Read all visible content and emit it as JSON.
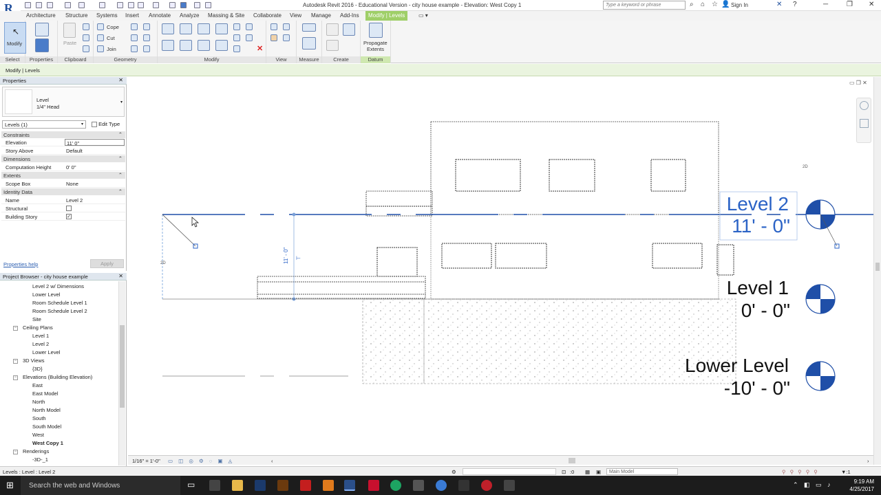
{
  "window": {
    "title": "Autodesk Revit 2016 - Educational Version -   city house example - Elevation: West Copy 1"
  },
  "search": {
    "placeholder": "Type a keyword or phrase"
  },
  "signin": "Sign In",
  "tabs": [
    "Architecture",
    "Structure",
    "Systems",
    "Insert",
    "Annotate",
    "Analyze",
    "Massing & Site",
    "Collaborate",
    "View",
    "Manage",
    "Add-Ins",
    "Modify | Levels"
  ],
  "ribbon": {
    "modify_label": "Modify",
    "cope": "Cope",
    "cut": "Cut",
    "join": "Join",
    "paste": "Paste",
    "propagate": "Propagate",
    "extents": "Extents",
    "panels": [
      "Select",
      "Properties",
      "Clipboard",
      "Geometry",
      "Modify",
      "View",
      "Measure",
      "Create",
      "Datum"
    ]
  },
  "context_bar": "Modify | Levels",
  "properties": {
    "title": "Properties",
    "type_family": "Level",
    "type_name": "1/4\" Head",
    "selector": "Levels (1)",
    "edit_type": "Edit Type",
    "sections": [
      {
        "name": "Constraints"
      },
      {
        "name": "Dimensions"
      },
      {
        "name": "Extents"
      },
      {
        "name": "Identity Data"
      }
    ],
    "rows": {
      "elevation": {
        "k": "Elevation",
        "v": "11'  0\""
      },
      "story_above": {
        "k": "Story Above",
        "v": "Default"
      },
      "computation_height": {
        "k": "Computation Height",
        "v": "0'  0\""
      },
      "scope_box": {
        "k": "Scope Box",
        "v": "None"
      },
      "name": {
        "k": "Name",
        "v": "Level 2"
      },
      "structural": {
        "k": "Structural",
        "v": ""
      },
      "building_story": {
        "k": "Building Story",
        "v": "✓"
      }
    },
    "help": "Properties help",
    "apply": "Apply"
  },
  "browser": {
    "title": "Project Browser - city house example",
    "items": [
      {
        "label": "Level 2 w/ Dimensions"
      },
      {
        "label": "Lower Level"
      },
      {
        "label": "Room Schedule Level 1"
      },
      {
        "label": "Room Schedule Level 2"
      },
      {
        "label": "Site"
      },
      {
        "label": "Ceiling Plans"
      },
      {
        "label": "Level 1"
      },
      {
        "label": "Level 2"
      },
      {
        "label": "Lower Level"
      },
      {
        "label": "3D Views"
      },
      {
        "label": "{3D}"
      },
      {
        "label": "Elevations (Building Elevation)"
      },
      {
        "label": "East"
      },
      {
        "label": "East Model"
      },
      {
        "label": "North"
      },
      {
        "label": "North Model"
      },
      {
        "label": "South"
      },
      {
        "label": "South Model"
      },
      {
        "label": "West"
      },
      {
        "label": "West Copy 1"
      },
      {
        "label": "Renderings"
      },
      {
        "label": "-3D-_1"
      }
    ]
  },
  "levels": [
    {
      "name": "Level 2",
      "elev": "11' - 0\"",
      "selected": true
    },
    {
      "name": "Level 1",
      "elev": "0' - 0\""
    },
    {
      "name": "Lower Level",
      "elev": "-10' - 0\""
    }
  ],
  "canvas_labels": {
    "twod_left": "2D",
    "twod_right": "2D",
    "dim_text": "11' - 0\""
  },
  "view_bar": {
    "scale": "1/16\" = 1'-0\""
  },
  "status": {
    "text": "Levels : Level : Level 2",
    "zero": ":0",
    "model": "Main Model"
  },
  "taskbar": {
    "search": "Search the web and Windows",
    "time": "9:19 AM",
    "date": "4/25/2017"
  },
  "colors": {
    "accent_green": "#9fcf68",
    "level_blue": "#1f4fa8",
    "selected_blue": "#2b63c6"
  }
}
